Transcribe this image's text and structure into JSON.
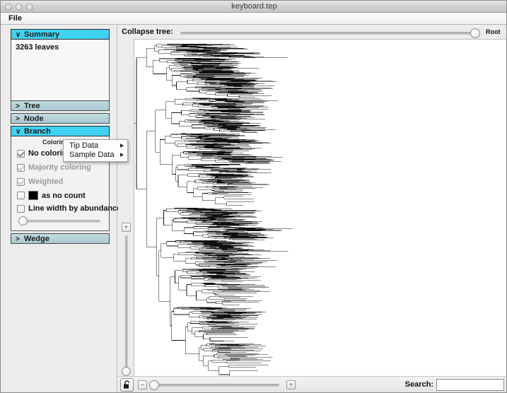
{
  "window": {
    "title": "keyboard.tep",
    "traffic_lights": [
      "close",
      "minimize",
      "zoom"
    ]
  },
  "menubar": {
    "items": [
      {
        "label": "File"
      }
    ]
  },
  "sidebar": {
    "panels": [
      {
        "id": "summary",
        "label": "Summary",
        "expanded": true,
        "chevron": "∨",
        "content": {
          "leaves_text": "3263 leaves"
        }
      },
      {
        "id": "tree",
        "label": "Tree",
        "expanded": false,
        "chevron": ">"
      },
      {
        "id": "node",
        "label": "Node",
        "expanded": false,
        "chevron": ">"
      },
      {
        "id": "branch",
        "label": "Branch",
        "expanded": true,
        "chevron": "∨",
        "content": {
          "coloring_by_label": "Coloring by",
          "options": [
            {
              "label": "No coloring",
              "checked": true,
              "enabled": true
            },
            {
              "label": "Majority coloring",
              "checked": true,
              "enabled": false
            },
            {
              "label": "Weighted",
              "checked": true,
              "enabled": false
            },
            {
              "label": "as no count",
              "checked": false,
              "enabled": true,
              "swatch_color": "#000000"
            },
            {
              "label": "Line width by abundance",
              "checked": false,
              "enabled": true
            }
          ],
          "slider_value": 0
        }
      },
      {
        "id": "wedge",
        "label": "Wedge",
        "expanded": false,
        "chevron": ">"
      }
    ]
  },
  "context_menu": {
    "items": [
      {
        "label": "Tip Data",
        "has_submenu": true
      },
      {
        "label": "Sample Data",
        "has_submenu": true
      }
    ]
  },
  "main": {
    "collapse": {
      "label": "Collapse tree:",
      "end_label": "Root",
      "value": 100
    },
    "vertical_zoom": {
      "plus_label": "+",
      "minus_label": "−",
      "value": 0
    }
  },
  "bottombar": {
    "lock_icon": "lock-icon",
    "zoom_out_label": "−",
    "zoom_in_label": "+",
    "horizontal_zoom_value": 0,
    "search_label": "Search:",
    "search_value": "",
    "search_placeholder": ""
  },
  "colors": {
    "panel_open_header": "#3fd2f2",
    "panel_closed_header": "#aec8d2",
    "window_chrome": "#ececec",
    "canvas": "#ffffff",
    "tree_stroke": "#111111"
  }
}
